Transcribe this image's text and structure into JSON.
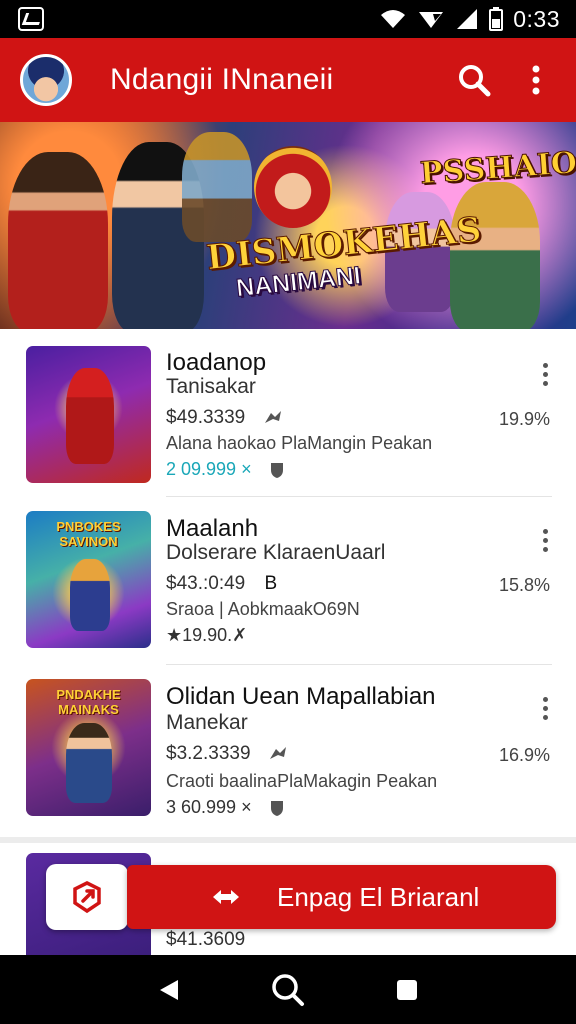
{
  "status_bar": {
    "time": "0:33"
  },
  "app_bar": {
    "title": "Ndangii INnaneii",
    "icons": [
      "avatar",
      "search-icon",
      "more-vert-icon"
    ]
  },
  "banner": {
    "title": "DISMOKEHAS",
    "subtitle": "NANIMANI",
    "badge": "PSSHAION"
  },
  "items": [
    {
      "name": "Ioadanop",
      "subtitle": "Tanisakar",
      "price": "$49.3339",
      "desc": "Alana haokao PlaMangin Peakan",
      "meta": "2 09.999 ×",
      "percent": "19.9%",
      "thumb_text": ""
    },
    {
      "name": "Maalanh",
      "subtitle": "Dolserare KlaraenUaarl",
      "price": "$43.:0:49",
      "price_badge": "B",
      "desc": "Sraoa | AobkmaakO69N",
      "meta": "★19.90.✗",
      "percent": "15.8%",
      "thumb_text": "PNBOKES SAVINON"
    },
    {
      "name": "Olidan Uean Mapallabian",
      "subtitle": "Manekar",
      "price": "$3.2.3339",
      "desc": "Craoti baalinaPlaMakagin Peakan",
      "meta": "3 60.999 ×",
      "percent": "16.9%",
      "thumb_text": "PNDAKHE MAINAKS"
    }
  ],
  "partial_item": {
    "price": "$41.3609"
  },
  "fab": {
    "label": "Enpag El Briaranl"
  },
  "colors": {
    "primary": "#d01414",
    "status_bar": "#000000",
    "nav_bar": "#000000"
  },
  "nav": {
    "icons": [
      "back-icon",
      "search-home-icon",
      "recents-icon"
    ]
  }
}
